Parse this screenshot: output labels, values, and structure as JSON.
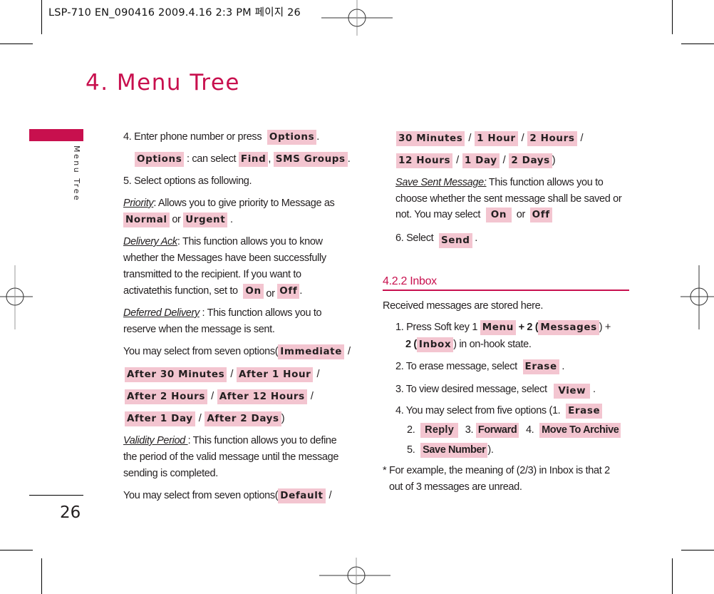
{
  "print_header": "LSP-710 EN_090416  2009.4.16 2:3 PM  페이지 26",
  "page": {
    "title": "4. Menu Tree",
    "side_label": "Menu Tree",
    "page_number": "26",
    "accent_color": "#c8104e",
    "key_highlight_color": "#f3c5d0"
  },
  "left": {
    "step4": {
      "text": "4. Enter phone number or press",
      "key": "Options",
      "end": "."
    },
    "options_line": {
      "key": "Options",
      "text": ": can select",
      "key2": "Find",
      "sep": ",",
      "key3": "SMS Groups",
      "end": "."
    },
    "step5": "5. Select options as following.",
    "priority": {
      "label": "Priority",
      "text": ": Allows you to give priority to Message as",
      "key1": "Normal",
      "or": "or",
      "key2": "Urgent",
      "end": "."
    },
    "delivery_ack": {
      "label": "Delivery Ack",
      "lines": [
        ": This function allows you to know",
        "whether the Messages have been successfully",
        "transmitted to the recipient. If you want to",
        "activatethis function, set to"
      ],
      "key1": "On",
      "or": "or",
      "key2": "Off",
      "end": "."
    },
    "deferred": {
      "label": "Deferred Delivery",
      "text": " :  This function allows you to",
      "line2": "reserve when the message is sent."
    },
    "deferred_options": {
      "intro": "You may select from seven options(",
      "options": [
        "Immediate",
        "After 30 Minutes",
        "After 1 Hour",
        "After 2 Hours",
        "After 12 Hours",
        "After 1 Day",
        "After 2 Days"
      ],
      "end": ")"
    },
    "validity": {
      "label": "Validity Period ",
      "text": ":  This function allows you to define",
      "line2": "the period of the valid message until the message",
      "line3": "sending is completed."
    },
    "validity_options": {
      "intro": "You may select from seven options(",
      "first": "Default"
    }
  },
  "right": {
    "validity_options_cont": [
      "30 Minutes",
      "1 Hour",
      "2 Hours",
      "12 Hours",
      "1 Day",
      "2 Days"
    ],
    "save_sent": {
      "label": "Save Sent Message:",
      "text": "  This function allows you to",
      "line2": "choose whether the sent  message shall be saved or",
      "line3": "not. You may select",
      "key1": "On",
      "or": "or",
      "key2": "Off"
    },
    "step6": {
      "text": "6. Select",
      "key": "Send",
      "end": "."
    },
    "section_title": "4.2.2 Inbox",
    "intro": "Received messages are stored here.",
    "inbox_step1": {
      "text": "1. Press Soft key 1",
      "key1": "Menu",
      "plus": "+ 2 (",
      "key2": "Messages",
      "close": ") +",
      "line2_pre": "2 (",
      "key3": "Inbox",
      "line2_post": ") in on-hook state."
    },
    "inbox_step2": {
      "text": "2. To erase message, select",
      "key": "Erase",
      "end": "."
    },
    "inbox_step3": {
      "text": "3. To view desired message, select",
      "key": "View",
      "end": "."
    },
    "inbox_step4": {
      "text": "4. You may select from five options (1.",
      "options": [
        {
          "num": "1.",
          "label": "Erase"
        },
        {
          "num": "2.",
          "label": "Reply"
        },
        {
          "num": "3.",
          "label": "Forward"
        },
        {
          "num": "4.",
          "label": "Move To Archive"
        },
        {
          "num": "5.",
          "label": "Save Number"
        }
      ],
      "end": ")."
    },
    "footnote": [
      "* For example, the meaning of (2/3) in Inbox is that 2",
      "out of 3 messages are unread."
    ]
  }
}
